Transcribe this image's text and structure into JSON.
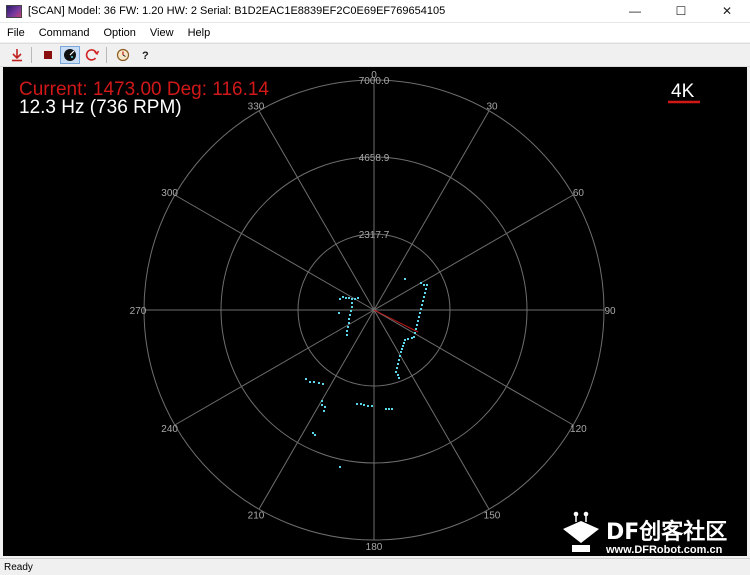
{
  "window": {
    "title": "[SCAN] Model: 36 FW: 1.20 HW: 2 Serial: B1D2EAC1E8839EF2C0E69EF769654105",
    "minimize_glyph": "—",
    "maximize_glyph": "☐",
    "close_glyph": "✕"
  },
  "menu": {
    "items": [
      "File",
      "Command",
      "Option",
      "View",
      "Help"
    ]
  },
  "toolbar": {
    "buttons": [
      {
        "name": "download-icon",
        "glyph": "⊥"
      },
      {
        "name": "stop-icon",
        "glyph": "■"
      },
      {
        "name": "scan-icon",
        "glyph": "◕"
      },
      {
        "name": "refresh-icon",
        "glyph": "↻"
      },
      {
        "name": "options-icon",
        "glyph": "◷"
      },
      {
        "name": "help-icon",
        "glyph": "?"
      }
    ]
  },
  "scan": {
    "current_line": "Current: 1473.00 Deg: 116.14",
    "rate_line": "12.3 Hz (736 RPM)",
    "mode_badge": "4K",
    "ring_labels": [
      "7000.0",
      "4658.9",
      "2317.7"
    ],
    "angle_labels": [
      "0",
      "30",
      "60",
      "90",
      "120",
      "150",
      "180",
      "210",
      "240",
      "270",
      "300",
      "330"
    ],
    "colors": {
      "background": "#000000",
      "grid": "#6e6e6e",
      "current_text": "#d01818",
      "rate_text": "#ffffff",
      "points": "#5ad7e6",
      "heading": "#c01818"
    }
  },
  "watermark": {
    "brand": "DF创客社区",
    "url": "www.DFRobot.com.cn"
  },
  "status": {
    "text": "Ready"
  }
}
